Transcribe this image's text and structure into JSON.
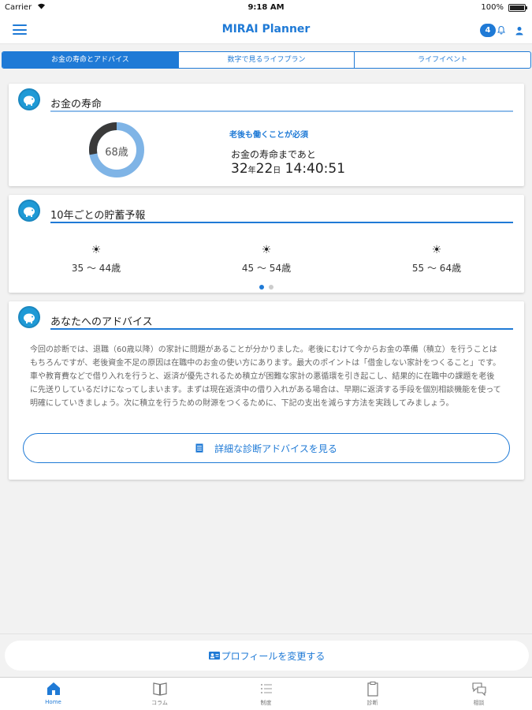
{
  "status_bar": {
    "carrier": "Carrier",
    "time": "9:18 AM",
    "battery": "100%"
  },
  "nav": {
    "title": "MIRAI Planner",
    "notification_count": "4"
  },
  "tabs": [
    {
      "label": "お金の寿命とアドバイス",
      "active": true
    },
    {
      "label": "数字で見るライフプラン",
      "active": false
    },
    {
      "label": "ライフイベント",
      "active": false
    }
  ],
  "lifespan_card": {
    "title": "お金の寿命",
    "age_label": "68歳",
    "donut_fill_fraction": 0.72,
    "must_work_text": "老後も働くことが必須",
    "remaining_label": "お金の寿命まであと",
    "countdown": {
      "years": "32",
      "years_unit": "年",
      "days": "22",
      "days_unit": "日",
      "time": " 14:40:51"
    }
  },
  "savings_card": {
    "title": "10年ごとの貯蓄予報",
    "forecasts": [
      {
        "icon": "sun-icon",
        "range": "35 ～ 44歳"
      },
      {
        "icon": "sun-icon",
        "range": "45 ～ 54歳"
      },
      {
        "icon": "sun-icon",
        "range": "55 ～ 64歳"
      }
    ],
    "page_count": 2,
    "current_page": 1
  },
  "advice_card": {
    "title": "あなたへのアドバイス",
    "body": "今回の診断では、退職（60歳以降）の家計に問題があることが分かりました。老後にむけて今からお金の準備（積立）を行うことはもちろんですが、老後資金不足の原因は在職中のお金の使い方にあります。最大のポイントは「借金しない家計をつくること」です。車や教育費などで借り入れを行うと、返済が優先されるため積立が困難な家計の悪循環を引き起こし、結果的に在職中の課題を老後に先送りしているだけになってしまいます。まずは現在返済中の借り入れがある場合は、早期に返済する手段を個別相談機能を使って明確にしていきましょう。次に積立を行うための財源をつくるために、下記の支出を減らす方法を実践してみましょう。",
    "detail_button": "詳細な診断アドバイスを見る"
  },
  "profile_button": "プロフィールを変更する",
  "tab_bar": [
    {
      "label": "Home",
      "icon": "home-icon",
      "active": true
    },
    {
      "label": "コラム",
      "icon": "book-icon",
      "active": false
    },
    {
      "label": "制度",
      "icon": "list-icon",
      "active": false
    },
    {
      "label": "診断",
      "icon": "clipboard-icon",
      "active": false
    },
    {
      "label": "相談",
      "icon": "chat-icon",
      "active": false
    }
  ],
  "colors": {
    "accent": "#1f7ad6",
    "donut_dark": "#3a3a3a",
    "donut_light": "#7fb4e6"
  }
}
